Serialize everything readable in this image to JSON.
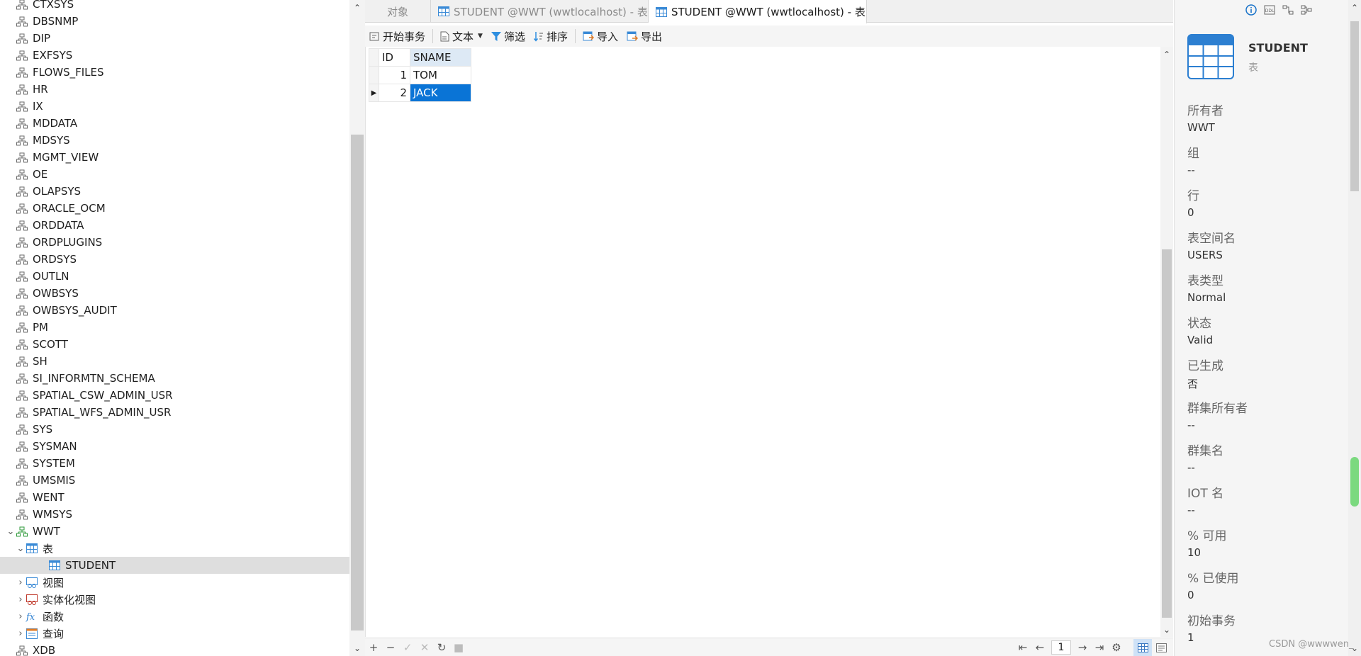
{
  "tree": {
    "items": [
      {
        "label": "CTXSYS",
        "type": "schema"
      },
      {
        "label": "DBSNMP",
        "type": "schema"
      },
      {
        "label": "DIP",
        "type": "schema"
      },
      {
        "label": "EXFSYS",
        "type": "schema"
      },
      {
        "label": "FLOWS_FILES",
        "type": "schema"
      },
      {
        "label": "HR",
        "type": "schema"
      },
      {
        "label": "IX",
        "type": "schema"
      },
      {
        "label": "MDDATA",
        "type": "schema"
      },
      {
        "label": "MDSYS",
        "type": "schema"
      },
      {
        "label": "MGMT_VIEW",
        "type": "schema"
      },
      {
        "label": "OE",
        "type": "schema"
      },
      {
        "label": "OLAPSYS",
        "type": "schema"
      },
      {
        "label": "ORACLE_OCM",
        "type": "schema"
      },
      {
        "label": "ORDDATA",
        "type": "schema"
      },
      {
        "label": "ORDPLUGINS",
        "type": "schema"
      },
      {
        "label": "ORDSYS",
        "type": "schema"
      },
      {
        "label": "OUTLN",
        "type": "schema"
      },
      {
        "label": "OWBSYS",
        "type": "schema"
      },
      {
        "label": "OWBSYS_AUDIT",
        "type": "schema"
      },
      {
        "label": "PM",
        "type": "schema"
      },
      {
        "label": "SCOTT",
        "type": "schema"
      },
      {
        "label": "SH",
        "type": "schema"
      },
      {
        "label": "SI_INFORMTN_SCHEMA",
        "type": "schema"
      },
      {
        "label": "SPATIAL_CSW_ADMIN_USR",
        "type": "schema"
      },
      {
        "label": "SPATIAL_WFS_ADMIN_USR",
        "type": "schema"
      },
      {
        "label": "SYS",
        "type": "schema"
      },
      {
        "label": "SYSMAN",
        "type": "schema"
      },
      {
        "label": "SYSTEM",
        "type": "schema"
      },
      {
        "label": "UMSMIS",
        "type": "schema"
      },
      {
        "label": "WENT",
        "type": "schema"
      },
      {
        "label": "WMSYS",
        "type": "schema"
      },
      {
        "label": "WWT",
        "type": "schema-active",
        "expanded": true
      },
      {
        "label": "表",
        "type": "tables",
        "expanded": true
      },
      {
        "label": "STUDENT",
        "type": "table",
        "selected": true
      },
      {
        "label": "视图",
        "type": "views",
        "collapsed": true
      },
      {
        "label": "实体化视图",
        "type": "mviews",
        "collapsed": true
      },
      {
        "label": "函数",
        "type": "functions",
        "collapsed": true
      },
      {
        "label": "查询",
        "type": "queries",
        "collapsed": true
      },
      {
        "label": "XDB",
        "type": "schema"
      }
    ]
  },
  "tabs": [
    {
      "label": "对象",
      "active": false
    },
    {
      "label": "STUDENT @WWT (wwtlocalhost) - 表",
      "active": false
    },
    {
      "label": "STUDENT @WWT (wwtlocalhost) - 表",
      "active": true
    }
  ],
  "toolbar": {
    "begin_tx": "开始事务",
    "text": "文本",
    "filter": "筛选",
    "sort": "排序",
    "import": "导入",
    "export": "导出"
  },
  "grid": {
    "columns": [
      "ID",
      "SNAME"
    ],
    "rows": [
      {
        "id": "1",
        "sname": "TOM"
      },
      {
        "id": "2",
        "sname": "JACK"
      }
    ]
  },
  "pager": {
    "page": "1"
  },
  "info": {
    "title": "STUDENT",
    "subtitle": "表",
    "props": [
      {
        "k": "所有者",
        "v": "WWT"
      },
      {
        "k": "组",
        "v": "--"
      },
      {
        "k": "行",
        "v": "0"
      },
      {
        "k": "表空间名",
        "v": "USERS"
      },
      {
        "k": "表类型",
        "v": "Normal"
      },
      {
        "k": "状态",
        "v": "Valid"
      },
      {
        "k": "已生成",
        "v": "否"
      },
      {
        "k": "群集所有者",
        "v": "--"
      },
      {
        "k": "群集名",
        "v": "--"
      },
      {
        "k": "IOT 名",
        "v": "--"
      },
      {
        "k": "% 可用",
        "v": "10"
      },
      {
        "k": "% 已使用",
        "v": "0"
      },
      {
        "k": "初始事务",
        "v": "1"
      }
    ]
  },
  "watermark": "CSDN @wwwwen_",
  "colors": {
    "selection": "#0a74d6",
    "header_highlight": "#dde9f5",
    "tree_selected": "#dedede",
    "schema_icon_active": "#2e9a3a"
  }
}
